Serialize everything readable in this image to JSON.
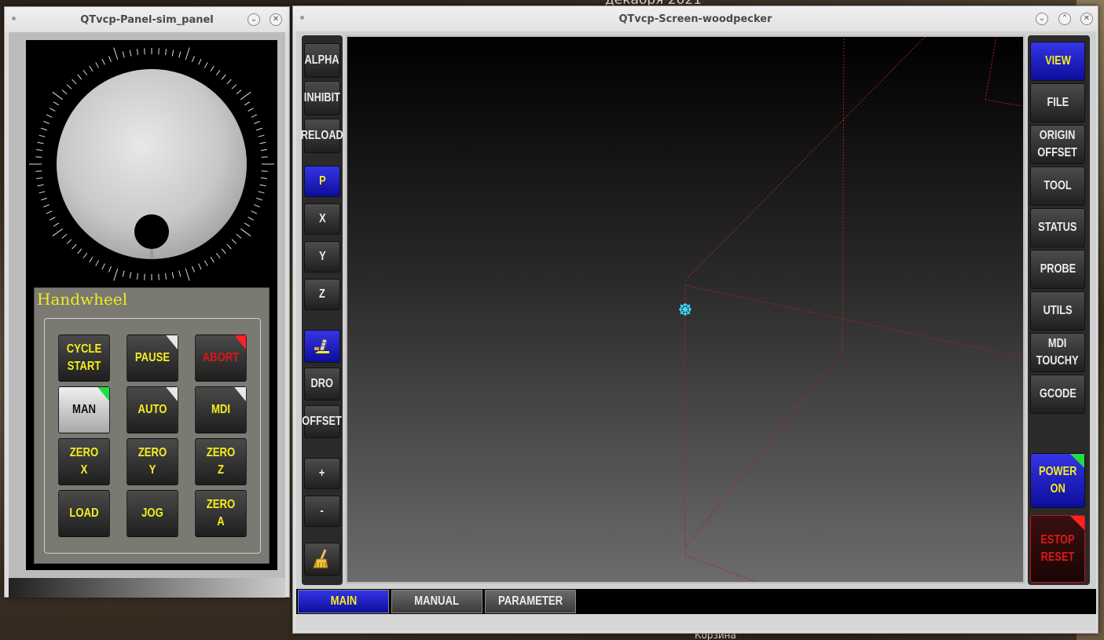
{
  "desktop": {
    "top_text": "декабря 2021",
    "bottom_text": "Корзина"
  },
  "panel_window": {
    "title": "QTvcp-Panel-sim_panel",
    "handwheel_title": "Handwheel",
    "buttons": [
      {
        "label": "CYCLE\nSTART",
        "state": "normal"
      },
      {
        "label": "PAUSE",
        "state": "normal",
        "indicator": "grey"
      },
      {
        "label": "ABORT",
        "state": "red",
        "indicator": "red"
      },
      {
        "label": "MAN",
        "state": "active",
        "indicator": "green"
      },
      {
        "label": "AUTO",
        "state": "normal",
        "indicator": "grey"
      },
      {
        "label": "MDI",
        "state": "normal",
        "indicator": "grey"
      },
      {
        "label": "ZERO\nX",
        "state": "normal"
      },
      {
        "label": "ZERO\nY",
        "state": "normal"
      },
      {
        "label": "ZERO\nZ",
        "state": "normal"
      },
      {
        "label": "LOAD",
        "state": "normal"
      },
      {
        "label": "JOG",
        "state": "normal"
      },
      {
        "label": "ZERO\nA",
        "state": "normal"
      }
    ]
  },
  "main_window": {
    "title": "QTvcp-Screen-woodpecker",
    "left_toolbar": {
      "alpha": "ALPHA",
      "inhibit": "INHIBIT",
      "reload": "RELOAD",
      "p": "P",
      "x": "X",
      "y": "Y",
      "z": "Z",
      "dro": "DRO",
      "offset": "OFFSET",
      "zoom_in": "+",
      "zoom_out": "-"
    },
    "right_toolbar": {
      "view": "VIEW",
      "file": "FILE",
      "origin_offset": "ORIGIN\nOFFSET",
      "tool": "TOOL",
      "status": "STATUS",
      "probe": "PROBE",
      "utils": "UTILS",
      "mdi_touchy": "MDI\nTOUCHY",
      "gcode": "GCODE",
      "power_on": "POWER\nON",
      "estop_reset": "ESTOP\nRESET"
    },
    "tabs": {
      "main": "MAIN",
      "manual": "MANUAL",
      "parameter": "PARAMETER"
    }
  },
  "colors": {
    "accent_yellow": "#f5ee1c",
    "active_blue": "#1a1ac8",
    "alert_red": "#e01818",
    "indicator_green": "#22dd44"
  },
  "icons": {
    "close": "close-icon",
    "minimize": "chevron-down-icon",
    "maximize": "chevron-up-icon",
    "home": "home-machine-icon",
    "clear": "broom-icon"
  }
}
